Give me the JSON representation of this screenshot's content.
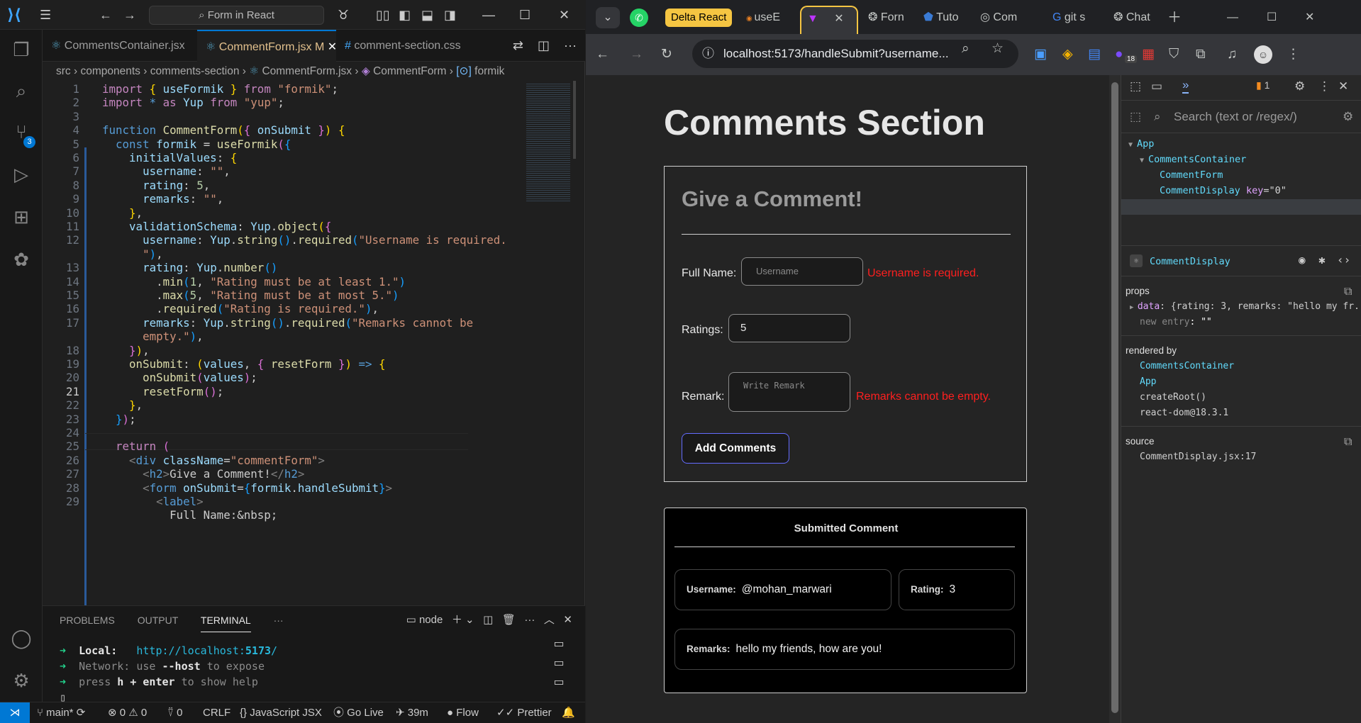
{
  "vscode": {
    "command_center": "Form in React",
    "scm_badge": "3",
    "tabs": [
      {
        "label": "CommentsContainer.jsx",
        "modified": ""
      },
      {
        "label": "CommentForm.jsx",
        "modified": "M"
      },
      {
        "label": "comment-section.css",
        "modified": ""
      }
    ],
    "breadcrumb": [
      "src",
      "components",
      "comments-section",
      "CommentForm.jsx",
      "CommentForm",
      "formik"
    ],
    "line_numbers": [
      "1",
      "2",
      "3",
      "4",
      "5",
      "6",
      "7",
      "8",
      "9",
      "10",
      "11",
      "12",
      "",
      "13",
      "14",
      "15",
      "16",
      "17",
      "",
      "18",
      "19",
      "20",
      "21",
      "22",
      "23",
      "24",
      "25",
      "26",
      "27",
      "28",
      "29"
    ],
    "panel_tabs": [
      "PROBLEMS",
      "OUTPUT",
      "TERMINAL"
    ],
    "terminal_shell": "node",
    "terminal": {
      "local_label": "Local:",
      "local_url_a": "http://localhost:",
      "local_port": "5173",
      "local_url_b": "/",
      "network_a": "Network:",
      "network_b": " use ",
      "network_c": "--host",
      "network_d": " to expose",
      "help_a": "press ",
      "help_b": "h + enter",
      "help_c": " to show help"
    },
    "status": {
      "branch": "main*",
      "errors": "0",
      "warnings": "0",
      "ports": "0",
      "eol": "CRLF",
      "language": "JavaScript JSX",
      "golive": "Go Live",
      "time": "39m",
      "flow": "Flow",
      "prettier": "Prettier"
    }
  },
  "browser": {
    "tabs": [
      "Delta React",
      "useE",
      "",
      "Forn",
      "Tuto",
      "Com",
      "git s",
      "Chat"
    ],
    "url": "localhost:5173/handleSubmit?username...",
    "extension_badge": "18",
    "page": {
      "title": "Comments Section",
      "form_title": "Give a Comment!",
      "fullname_label": "Full Name:",
      "username_placeholder": "Username",
      "username_error": "Username is required.",
      "ratings_label": "Ratings:",
      "rating_value": "5",
      "remark_label": "Remark:",
      "remark_placeholder": "Write Remark",
      "remark_error": "Remarks cannot be empty.",
      "submit_label": "Add Comments",
      "submitted_title": "Submitted Comment",
      "username_label": "Username:",
      "username_value": "@mohan_marwari",
      "rating_label": "Rating:",
      "rating_shown": "3",
      "remarks_label": "Remarks:",
      "remarks_value": "hello my friends, how are you!"
    }
  },
  "devtools": {
    "issues_count": "1",
    "search_placeholder": "Search (text or /regex/)",
    "tree": {
      "app": "App",
      "container": "CommentsContainer",
      "form": "CommentForm",
      "display": "CommentDisplay",
      "key_name": "key",
      "key_value": "=\"0\""
    },
    "selected": "CommentDisplay",
    "props_title": "props",
    "prop_data_key": "data",
    "prop_data_value": ": {rating: 3, remarks: \"hello my fr...",
    "new_entry_key": "new entry",
    "new_entry_value": ": \"\"",
    "rendered_by_title": "rendered by",
    "rendered_by": [
      "CommentsContainer",
      "App",
      "createRoot()",
      "react-dom@18.3.1"
    ],
    "source_title": "source",
    "source_value": "CommentDisplay.jsx:17"
  }
}
